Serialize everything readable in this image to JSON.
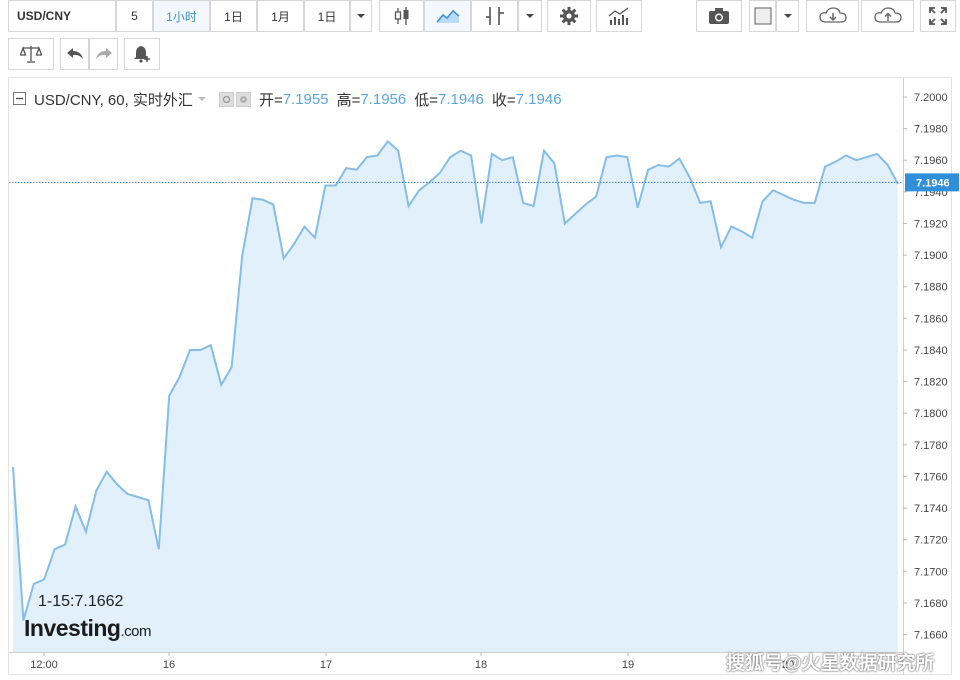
{
  "toolbar": {
    "symbol": "USD/CNY",
    "intervals": [
      "5",
      "1小时",
      "1日",
      "1月",
      "1日"
    ],
    "active_interval": "1小时",
    "icons": [
      "candlestick-icon",
      "area-chart-icon",
      "indicator-icon",
      "dropdown-icon",
      "settings-icon",
      "volume-chart-icon",
      "camera-icon",
      "color-swatch-icon",
      "dropdown-icon",
      "cloud-download-icon",
      "cloud-upload-icon",
      "fullscreen-icon"
    ]
  },
  "toolbar2": {
    "icons": [
      "scales-icon",
      "undo-icon",
      "redo-icon",
      "alert-bell-icon"
    ]
  },
  "legend": {
    "title": "USD/CNY, 60, 实时外汇",
    "open_label": "开=",
    "open": "7.1955",
    "high_label": "高=",
    "high": "7.1956",
    "low_label": "低=",
    "low": "7.1946",
    "close_label": "收=",
    "close": "7.1946"
  },
  "tooltip": "1-15:7.1662",
  "logo": {
    "brand": "Investing",
    "suffix": ".com"
  },
  "watermark": "搜狐号@火星数据研究所",
  "colors": {
    "line": "#86bde6",
    "fill": "#e1f0fa",
    "accent": "#3f90d4",
    "last_price_bg": "#2f8fd8"
  },
  "chart_data": {
    "type": "area",
    "title": "USD/CNY, 60, 实时外汇",
    "xlabel": "",
    "ylabel": "",
    "x_tick_labels": [
      "12:00",
      "16",
      "17",
      "18",
      "19",
      "20"
    ],
    "y_tick_labels": [
      "7.2000",
      "7.1980",
      "7.1960",
      "7.1940",
      "7.1920",
      "7.1900",
      "7.1880",
      "7.1860",
      "7.1840",
      "7.1820",
      "7.1800",
      "7.1780",
      "7.1760",
      "7.1740",
      "7.1720",
      "7.1700",
      "7.1680",
      "7.1660"
    ],
    "ylim": [
      7.1649,
      7.2012
    ],
    "last_price": 7.1946,
    "grid": false,
    "series": [
      {
        "values": [
          7.1766,
          7.1669,
          7.1692,
          7.1695,
          7.1714,
          7.1717,
          7.1741,
          7.1725,
          7.1751,
          7.1763,
          7.1755,
          7.1749,
          7.1747,
          7.1745,
          7.1714,
          7.1811,
          7.1823,
          7.184,
          7.184,
          7.1843,
          7.1818,
          7.1829,
          7.1899,
          7.1936,
          7.1935,
          7.1932,
          7.1898,
          7.1907,
          7.1918,
          7.1911,
          7.1944,
          7.1944,
          7.1955,
          7.1954,
          7.1962,
          7.1963,
          7.1972,
          7.1966,
          7.1931,
          7.1941,
          7.1946,
          7.1952,
          7.1962,
          7.1966,
          7.1963,
          7.192,
          7.1964,
          7.196,
          7.1962,
          7.1933,
          7.1931,
          7.1966,
          7.1958,
          7.192,
          7.1926,
          7.1932,
          7.1937,
          7.1962,
          7.1963,
          7.1962,
          7.193,
          7.1954,
          7.1957,
          7.1956,
          7.1961,
          7.1949,
          7.1933,
          7.1934,
          7.1905,
          7.1918,
          7.1915,
          7.1911,
          7.1934,
          7.1941,
          7.1938,
          7.1935,
          7.1933,
          7.1933,
          7.1956,
          7.1959,
          7.1963,
          7.196,
          7.1962,
          7.1964,
          7.1957,
          7.1945
        ]
      }
    ]
  }
}
